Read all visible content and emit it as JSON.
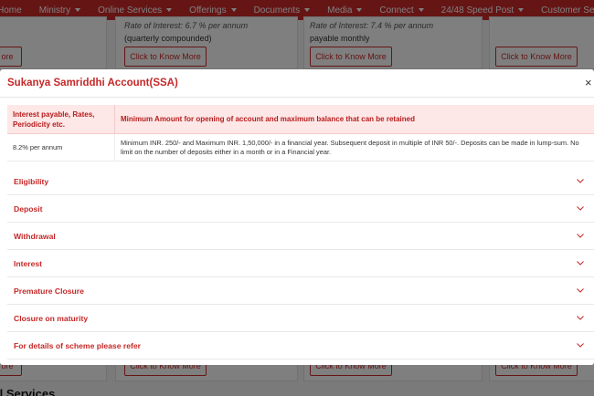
{
  "nav": {
    "items": [
      {
        "label": "Home",
        "caret": false
      },
      {
        "label": "Ministry",
        "caret": true
      },
      {
        "label": "Online Services",
        "caret": true
      },
      {
        "label": "Offerings",
        "caret": true
      },
      {
        "label": "Documents",
        "caret": true
      },
      {
        "label": "Media",
        "caret": true
      },
      {
        "label": "Connect",
        "caret": true
      },
      {
        "label": "24/48 Speed Post",
        "caret": true
      },
      {
        "label": "Customer Self Service Po",
        "caret": false
      }
    ]
  },
  "background": {
    "card1_rate": "Rate of Interest: 6.7 % per annum",
    "card1_note": "(quarterly compounded)",
    "card2_rate": "Rate of Interest: 7.4 % per annum",
    "card2_note": "payable monthly",
    "know_more_label": "Click to Know More",
    "know_more_short": "ore",
    "bottom_heading": "il Services"
  },
  "modal": {
    "title": "Sukanya Samriddhi Account(SSA)",
    "close": "×",
    "table": {
      "headers": [
        "Interest payable, Rates, Periodicity etc.",
        "Minimum Amount for opening of account and maximum balance that can be retained"
      ],
      "rows": [
        [
          "8.2% per annum",
          "Minimum INR. 250/- and Maximum INR. 1,50,000/- in a financial year. Subsequent deposit in multiple of INR 50/-. Deposits can be made in lump-sum. No limit on the number of deposits either in a month or in a Financial year."
        ]
      ]
    },
    "sections": [
      "Eligibility",
      "Deposit",
      "Withdrawal",
      "Interest",
      "Premature Closure",
      "Closure on maturity",
      "For details of scheme please refer"
    ]
  },
  "colors": {
    "brand_red": "#cd2a2a",
    "heading_red": "#c62828",
    "table_header_bg": "#fde7e7",
    "overlay": "rgba(0,0,0,0.5)"
  },
  "icons": {
    "close": "close-icon",
    "accordion": "chevron-down-icon",
    "nav_dropdown": "caret-down-icon"
  }
}
